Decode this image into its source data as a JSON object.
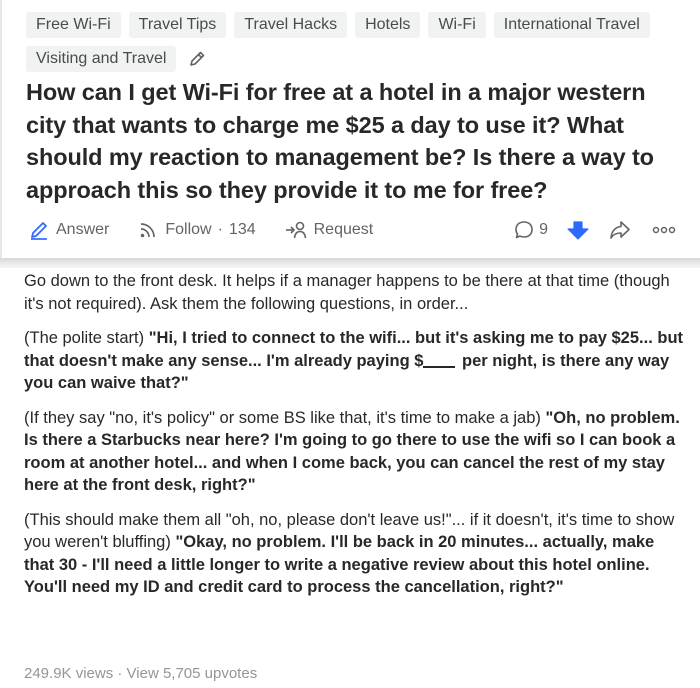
{
  "question": {
    "tags": [
      "Free Wi-Fi",
      "Travel Tips",
      "Travel Hacks",
      "Hotels",
      "Wi-Fi",
      "International Travel",
      "Visiting and Travel"
    ],
    "title": "How can I get Wi-Fi for free at a hotel in a major western city that wants to charge me $25 a day to use it? What should my reaction to management be? Is there a way to approach this so they provide it to me for free?",
    "actions": {
      "answer_label": "Answer",
      "follow_label": "Follow",
      "follow_separator": "·",
      "follow_count": "134",
      "request_label": "Request",
      "comment_count": "9"
    }
  },
  "answer": {
    "p1": "Go down to the front desk. It helps if a manager happens to be there at that time (though it's not required). Ask them the following questions, in order...",
    "p2_plain": "(The polite start) ",
    "p2_bold_a": "\"Hi, I tried to connect to the wifi... but it's asking me to pay $25... but that doesn't make any sense... I'm already paying $",
    "p2_bold_b": " per night, is there any way you can waive that?\"",
    "p3_plain": "(If they say \"no, it's policy\" or some BS like that, it's time to make a jab) ",
    "p3_bold": "\"Oh, no problem. Is there a Starbucks near here? I'm going to go there to use the wifi so I can book a room at another hotel... and when I come back, you can cancel the rest of my stay here at the front desk, right?\"",
    "p4_plain": "(This should make them all \"oh, no, please don't leave us!\"... if it doesn't, it's time to show you weren't bluffing) ",
    "p4_bold": "\"Okay, no problem. I'll be back in 20 minutes... actually, make that 30 - I'll need a little longer to write a negative review about this hotel online. You'll need my ID and credit card to process the cancellation, right?\"",
    "stats": "249.9K views · View 5,705 upvotes"
  },
  "colors": {
    "accent_blue": "#2e69ff",
    "text": "#282829",
    "muted": "#636466",
    "tag_bg": "#f1f2f2"
  },
  "icons": [
    "pencil-icon",
    "edit-answer-icon",
    "follow-wifi-icon",
    "request-icon",
    "comment-icon",
    "downvote-icon",
    "share-icon",
    "more-icon"
  ]
}
